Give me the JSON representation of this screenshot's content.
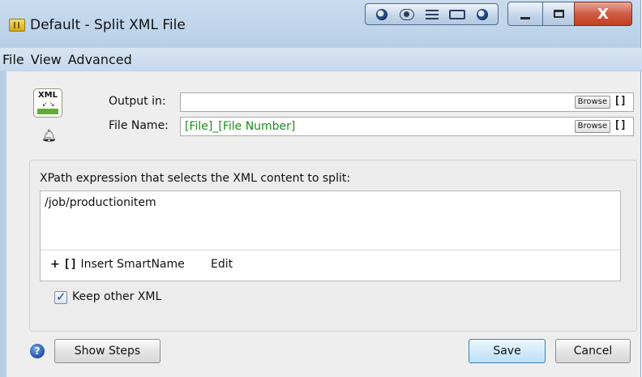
{
  "window": {
    "title": "Default - Split XML File",
    "icons": [
      "app-icon",
      "record-icon",
      "eye-icon",
      "list-icon",
      "window-icon",
      "record-icon",
      "minimize-icon",
      "maximize-icon",
      "close-icon"
    ],
    "close_glyph": "X"
  },
  "menu": {
    "items": [
      "File",
      "View",
      "Advanced"
    ]
  },
  "element": {
    "icon_text": "XML",
    "icons": [
      "xml-element-icon",
      "bell-icon"
    ]
  },
  "fields": {
    "output_label": "Output in:",
    "output_value": "",
    "filename_label": "File Name:",
    "filename_value": "[File]_[File Number]",
    "browse_label": "Browse",
    "smartname_glyph": "[]"
  },
  "xpath": {
    "label": "XPath expression that selects the XML content to split:",
    "value": "/job/productionitem",
    "insert_plus": "+",
    "insert_brackets": "[]",
    "insert_label": "Insert SmartName",
    "edit_label": "Edit"
  },
  "options": {
    "keep_other_xml_label": "Keep other XML",
    "keep_other_xml_checked": true
  },
  "footer": {
    "help_glyph": "?",
    "show_steps_label": "Show Steps",
    "save_label": "Save",
    "cancel_label": "Cancel"
  },
  "colors": {
    "value_text": "#1a8f1a",
    "close_button": "#c2401f",
    "green_bar": "#5cb02d"
  }
}
